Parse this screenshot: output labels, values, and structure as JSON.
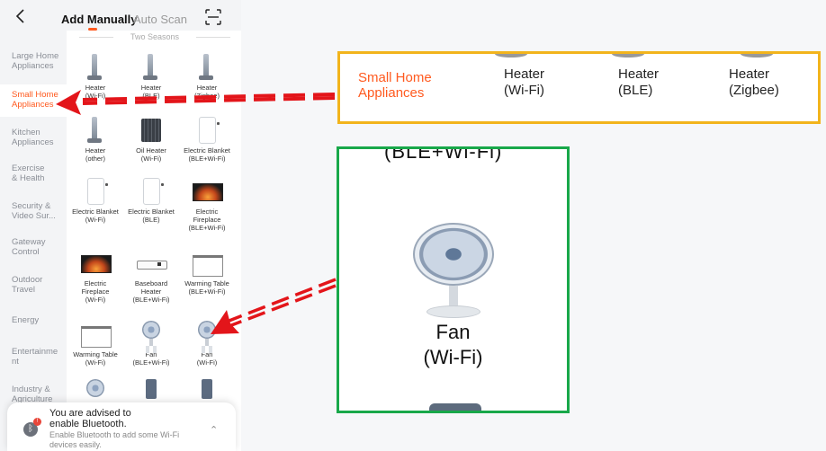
{
  "header": {
    "tab_add_manually": "Add Manually",
    "tab_auto_scan": "Auto Scan"
  },
  "sidebar": {
    "items": [
      {
        "label": "Large Home\nAppliances"
      },
      {
        "label": "Small Home\nAppliances"
      },
      {
        "label": "Kitchen\nAppliances"
      },
      {
        "label": "Exercise\n& Health"
      },
      {
        "label": "Security &\nVideo Sur..."
      },
      {
        "label": "Gateway\nControl"
      },
      {
        "label": "Outdoor\nTravel"
      },
      {
        "label": "Energy"
      },
      {
        "label": "Entertainme\nnt"
      },
      {
        "label": "Industry &\nAgriculture"
      }
    ],
    "active": "Small Home Appliances"
  },
  "content": {
    "section_title": "Two Seasons",
    "tiles": [
      {
        "label": "Heater\n(Wi-Fi)",
        "icon": "heater-icon"
      },
      {
        "label": "Heater\n(BLE)",
        "icon": "heater-icon"
      },
      {
        "label": "Heater\n(Zigbee)",
        "icon": "heater-icon"
      },
      {
        "label": "Heater\n(other)",
        "icon": "heater-icon"
      },
      {
        "label": "Oil Heater\n(Wi-Fi)",
        "icon": "oil-heater-icon"
      },
      {
        "label": "Electric Blanket\n(BLE+Wi-Fi)",
        "icon": "electric-blanket-icon"
      },
      {
        "label": "Electric Blanket\n(Wi-Fi)",
        "icon": "electric-blanket-icon"
      },
      {
        "label": "Electric Blanket\n(BLE)",
        "icon": "electric-blanket-icon"
      },
      {
        "label": "Electric\nFireplace\n(BLE+Wi-Fi)",
        "icon": "fireplace-icon"
      },
      {
        "label": "Electric\nFireplace\n(Wi-Fi)",
        "icon": "fireplace-icon"
      },
      {
        "label": "Baseboard\nHeater\n(BLE+Wi-Fi)",
        "icon": "baseboard-heater-icon"
      },
      {
        "label": "Warming Table\n(BLE+Wi-Fi)",
        "icon": "warming-table-icon"
      },
      {
        "label": "Warming Table\n(Wi-Fi)",
        "icon": "warming-table-icon"
      },
      {
        "label": "Fan\n(BLE+Wi-Fi)",
        "icon": "fan-icon"
      },
      {
        "label": "Fan\n(Wi-Fi)",
        "icon": "fan-icon"
      },
      {
        "label": "",
        "icon": "fan-icon"
      },
      {
        "label": "",
        "icon": "device-icon"
      },
      {
        "label": "",
        "icon": "device-icon"
      }
    ]
  },
  "bluetooth_card": {
    "title": "You are advised to\nenable Bluetooth.",
    "subtitle": "Enable Bluetooth to add some Wi-Fi\ndevices easily.",
    "badge": "!"
  },
  "zoom_yellow": {
    "category": "Small Home\nAppliances",
    "items": [
      "Heater\n(Wi-Fi)",
      "Heater\n(BLE)",
      "Heater\n(Zigbee)"
    ]
  },
  "zoom_green": {
    "partial_text": "(BLE+Wi-Fi)",
    "label": "Fan\n(Wi-Fi)"
  },
  "colors": {
    "accent": "#ff5a1f",
    "yellow_box": "#f2b41c",
    "green_box": "#18a84a",
    "arrow_red": "#e3151a"
  }
}
